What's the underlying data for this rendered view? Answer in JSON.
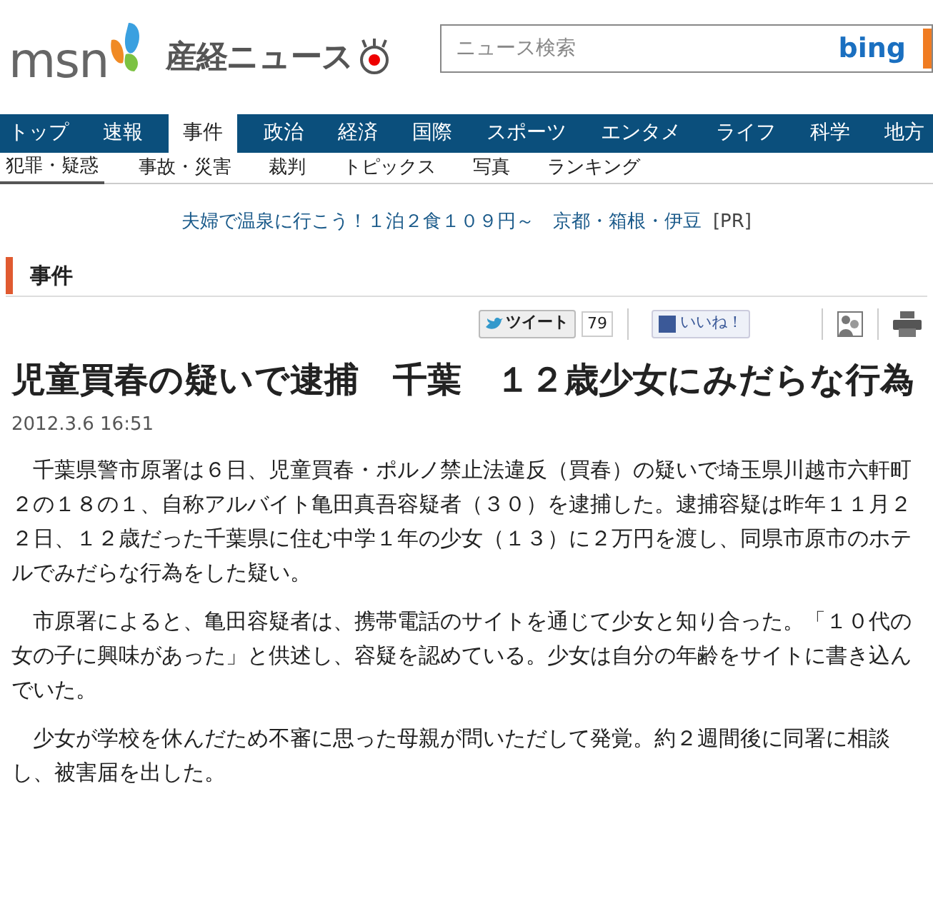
{
  "header": {
    "msn_logo": "msn",
    "site_name": "産経ニュース",
    "search": {
      "placeholder": "ニュース検索",
      "button": "bing"
    }
  },
  "nav": [
    {
      "label": "トップ",
      "selected": false
    },
    {
      "label": "速報",
      "selected": false
    },
    {
      "label": "事件",
      "selected": true
    },
    {
      "label": "政治",
      "selected": false
    },
    {
      "label": "経済",
      "selected": false
    },
    {
      "label": "国際",
      "selected": false
    },
    {
      "label": "スポーツ",
      "selected": false
    },
    {
      "label": "エンタメ",
      "selected": false
    },
    {
      "label": "ライフ",
      "selected": false
    },
    {
      "label": "科学",
      "selected": false
    },
    {
      "label": "地方",
      "selected": false
    }
  ],
  "subnav": [
    {
      "label": "犯罪・疑惑",
      "selected": true
    },
    {
      "label": "事故・災害",
      "selected": false
    },
    {
      "label": "裁判",
      "selected": false
    },
    {
      "label": "トピックス",
      "selected": false
    },
    {
      "label": "写真",
      "selected": false
    },
    {
      "label": "ランキング",
      "selected": false
    }
  ],
  "ad": {
    "text": "夫婦で温泉に行こう！１泊２食１０９円～　京都・箱根・伊豆",
    "tag": "[PR]"
  },
  "section_title": "事件",
  "share": {
    "tweet": "ツイート",
    "tweet_count": "79",
    "like": "いいね！"
  },
  "article": {
    "headline": "児童買春の疑いで逮捕　千葉　１２歳少女にみだらな行為",
    "date": "2012.3.6 16:51",
    "paragraphs": [
      "千葉県警市原署は６日、児童買春・ポルノ禁止法違反（買春）の疑いで埼玉県川越市六軒町２の１８の１、自称アルバイト亀田真吾容疑者（３０）を逮捕した。逮捕容疑は昨年１１月２２日、１２歳だった千葉県に住む中学１年の少女（１３）に２万円を渡し、同県市原市のホテルでみだらな行為をした疑い。",
      "市原署によると、亀田容疑者は、携帯電話のサイトを通じて少女と知り合った。「１０代の女の子に興味があった」と供述し、容疑を認めている。少女は自分の年齢をサイトに書き込んでいた。",
      "少女が学校を休んだため不審に思った母親が問いただして発覚。約２週間後に同署に相談し、被害届を出した。"
    ]
  }
}
